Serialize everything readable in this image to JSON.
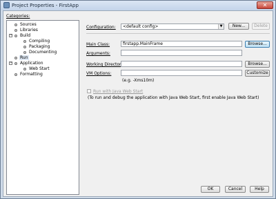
{
  "window": {
    "title": "Project Properties - FirstApp"
  },
  "categories": {
    "label": "Categories:",
    "items": [
      {
        "label": "Sources",
        "level": 1,
        "expander": ""
      },
      {
        "label": "Libraries",
        "level": 1,
        "expander": ""
      },
      {
        "label": "Build",
        "level": 1,
        "expander": "−"
      },
      {
        "label": "Compiling",
        "level": 2,
        "expander": ""
      },
      {
        "label": "Packaging",
        "level": 2,
        "expander": ""
      },
      {
        "label": "Documenting",
        "level": 2,
        "expander": ""
      },
      {
        "label": "Run",
        "level": 1,
        "expander": "",
        "selected": true
      },
      {
        "label": "Application",
        "level": 1,
        "expander": "−"
      },
      {
        "label": "Web Start",
        "level": 2,
        "expander": ""
      },
      {
        "label": "Formatting",
        "level": 1,
        "expander": ""
      }
    ]
  },
  "configuration": {
    "label": "Configuration:",
    "value": "<default config>",
    "new_label": "New...",
    "delete_label": "Delete"
  },
  "main_class": {
    "label": "Main Class:",
    "value": "firstapp.MainFrame",
    "browse_label": "Browse..."
  },
  "arguments": {
    "label": "Arguments:",
    "value": ""
  },
  "working_directory": {
    "label": "Working Directory:",
    "value": "",
    "browse_label": "Browse..."
  },
  "vm_options": {
    "label": "VM Options:",
    "value": "",
    "customize_label": "Customize",
    "hint": "(e.g. -Xms10m)"
  },
  "web_start": {
    "checkbox_label": "Run with Java Web Start",
    "note": "(To run and debug the application with Java Web Start, first enable Java Web Start)"
  },
  "footer": {
    "ok_label": "OK",
    "cancel_label": "Cancel",
    "help_label": "Help"
  }
}
